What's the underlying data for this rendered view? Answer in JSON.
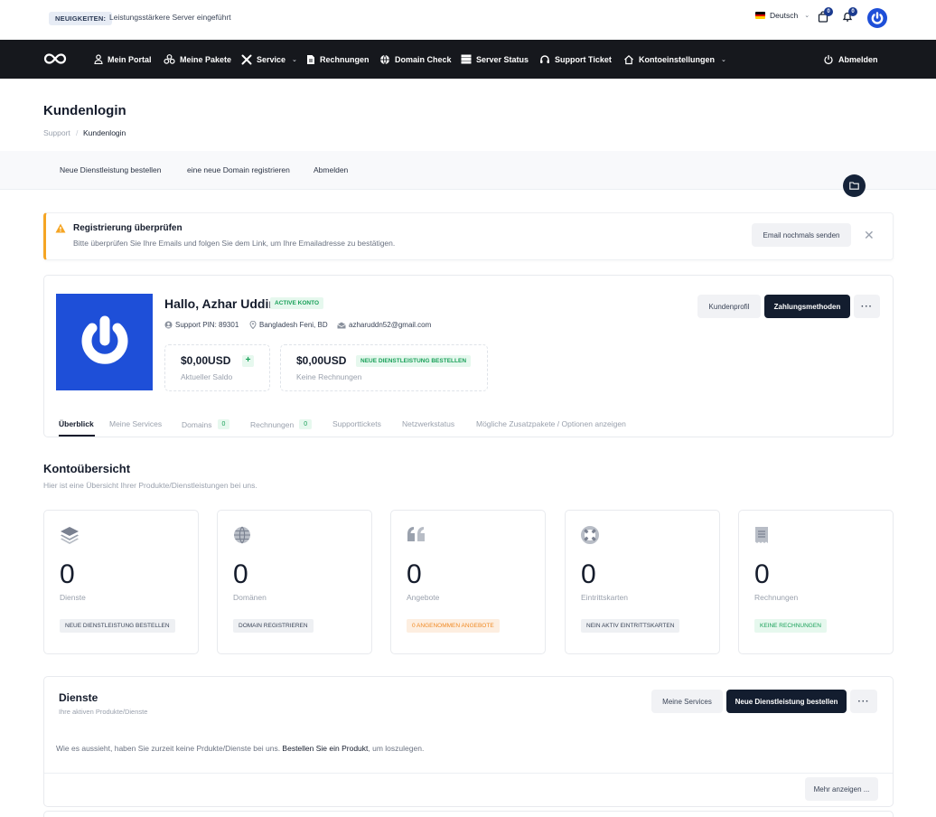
{
  "topbar": {
    "news_badge": "NEUIGKEITEN:",
    "news_text": "Leistungsstärkere Server eingeführt",
    "language": "Deutsch",
    "cart_count": "0",
    "notif_count": "0"
  },
  "nav": {
    "items": [
      {
        "label": "Mein Portal",
        "icon": "user-icon"
      },
      {
        "label": "Meine Pakete",
        "icon": "packages-icon"
      },
      {
        "label": "Service",
        "icon": "tools-icon"
      },
      {
        "label": "Rechnungen",
        "icon": "document-icon"
      },
      {
        "label": "Domain Check",
        "icon": "globe-icon"
      },
      {
        "label": "Server Status",
        "icon": "server-icon"
      },
      {
        "label": "Support Ticket",
        "icon": "headset-icon"
      },
      {
        "label": "Kontoeinstellungen",
        "icon": "home-icon"
      }
    ],
    "logout": "Abmelden"
  },
  "header": {
    "title": "Kundenlogin",
    "breadcrumb": [
      "Support",
      "Kundenlogin"
    ]
  },
  "subnav": [
    "Neue Dienstleistung bestellen",
    "eine neue Domain registrieren",
    "Abmelden"
  ],
  "alert": {
    "title": "Registrierung überprüfen",
    "text": "Bitte überprüfen Sie Ihre Emails und folgen Sie dem Link, um Ihre Emailadresse zu bestätigen.",
    "button": "Email nochmals senden",
    "color": "#f5a524"
  },
  "profile": {
    "greeting": "Hallo, Azhar Uddin",
    "status": "ACTIVE KONTO",
    "support_pin": "Support PIN: 89301",
    "location": "Bangladesh Feni, BD",
    "email": "azharuddn52@gmail.com",
    "balance": {
      "value": "$0,00USD",
      "label": "Aktueller Saldo"
    },
    "invoices": {
      "value": "$0,00USD",
      "label": "Keine Rechnungen",
      "badge": "NEUE DIENSTLEISTUNG BESTELLEN"
    },
    "buttons": {
      "profile": "Kundenprofil",
      "payment": "Zahlungsmethoden",
      "more": "···"
    },
    "tabs": [
      {
        "label": "Überblick"
      },
      {
        "label": "Meine Services"
      },
      {
        "label": "Domains",
        "count": "0"
      },
      {
        "label": "Rechnungen",
        "count": "0"
      },
      {
        "label": "Supporttickets"
      },
      {
        "label": "Netzwerkstatus"
      },
      {
        "label": "Mögliche Zusatzpakete / Optionen anzeigen"
      }
    ]
  },
  "overview": {
    "title": "Kontoübersicht",
    "subtitle": "Hier ist eine Übersicht Ihrer Produkte/Dienstleistungen bei uns.",
    "cards": [
      {
        "icon": "layers-icon",
        "value": "0",
        "label": "Dienste",
        "badge": "NEUE DIENSTLEISTUNG BESTELLEN",
        "badge_style": "gray"
      },
      {
        "icon": "globe-icon",
        "value": "0",
        "label": "Domänen",
        "badge": "DOMAIN REGISTRIEREN",
        "badge_style": "gray"
      },
      {
        "icon": "quote-icon",
        "value": "0",
        "label": "Angebote",
        "badge": "0 ANGENOMMEN ANGEBOTE",
        "badge_style": "orange"
      },
      {
        "icon": "lifebuoy-icon",
        "value": "0",
        "label": "Eintrittskarten",
        "badge": "NEIN AKTIV EINTRITTSKARTEN",
        "badge_style": "gray"
      },
      {
        "icon": "receipt-icon",
        "value": "0",
        "label": "Rechnungen",
        "badge": "KEINE RECHNUNGEN",
        "badge_style": "green"
      }
    ]
  },
  "services": {
    "title": "Dienste",
    "subtitle": "Ihre aktiven Produkte/Dienste",
    "text_before": "Wie es aussieht, haben Sie zurzeit keine Prdukte/Dienste bei uns. ",
    "text_link": "Bestellen Sie ein Produkt",
    "text_after": ", um loszulegen.",
    "btn_my": "Meine Services",
    "btn_new": "Neue Dienstleistung bestellen",
    "btn_more": "···",
    "show_more": "Mehr anzeigen ..."
  },
  "colors": {
    "brand": "#1e4fd8",
    "nav_bg": "#16181d",
    "dark_button": "#131d2f",
    "success": "#18a058"
  }
}
